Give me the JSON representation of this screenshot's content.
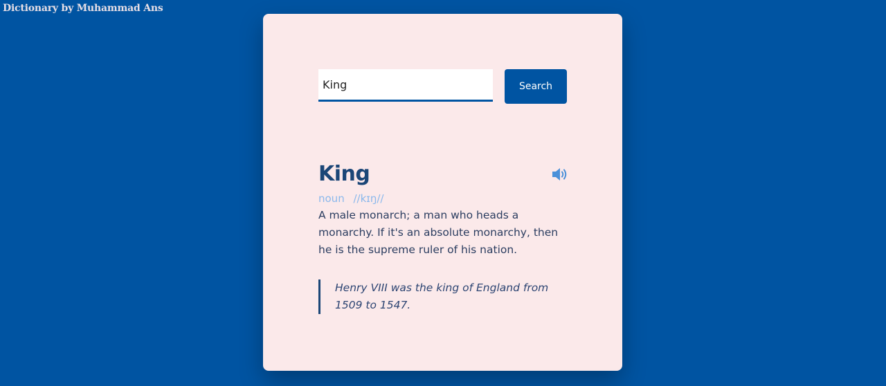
{
  "brand": {
    "title": "Dictionary by Muhammad Ans"
  },
  "search": {
    "value": "King",
    "button_label": "Search"
  },
  "result": {
    "word": "King",
    "part_of_speech": "noun",
    "phonetic": "//kɪŋ//",
    "definition": "A male monarch; a man who heads a monarchy. If it's an absolute monarchy, then he is the supreme ruler of his nation.",
    "example": "Henry VIII was the king of England from 1509 to 1547.",
    "sound_icon": "speaker-volume-icon"
  },
  "colors": {
    "background": "#0054a2",
    "card": "#fbe9ea",
    "accent": "#0054a2",
    "word": "#1b4677",
    "meta": "#8ab8ec",
    "speaker": "#4a90d9"
  }
}
